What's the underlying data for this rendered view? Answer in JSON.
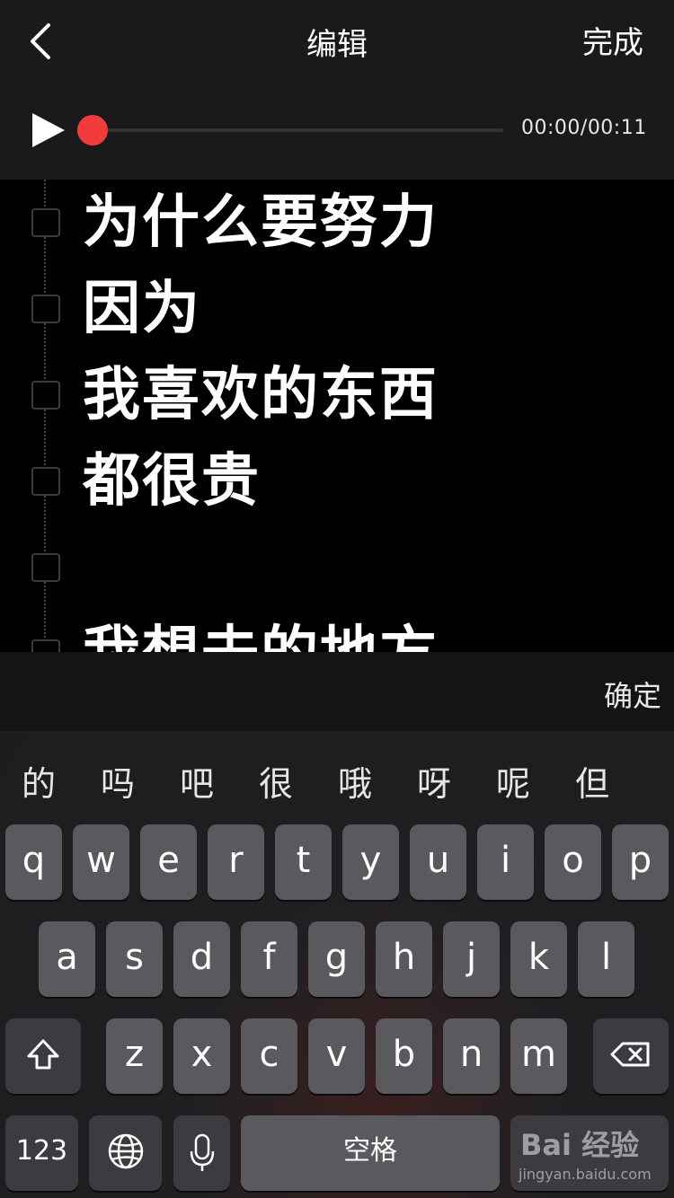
{
  "header": {
    "title": "编辑",
    "done_label": "完成"
  },
  "player": {
    "time": "00:00/00:11",
    "progress": 0
  },
  "lyrics": [
    "为什么要努力",
    "因为",
    "我喜欢的东西",
    "都很贵",
    "",
    "我想去的地方"
  ],
  "keyboard": {
    "confirm_label": "确定",
    "candidates": [
      "的",
      "吗",
      "吧",
      "很",
      "哦",
      "呀",
      "呢",
      "但"
    ],
    "row1": [
      "q",
      "w",
      "e",
      "r",
      "t",
      "y",
      "u",
      "i",
      "o",
      "p"
    ],
    "row2": [
      "a",
      "s",
      "d",
      "f",
      "g",
      "h",
      "j",
      "k",
      "l"
    ],
    "row3": [
      "z",
      "x",
      "c",
      "v",
      "b",
      "n",
      "m"
    ],
    "numbers_label": "123",
    "space_label": "空格"
  },
  "watermark": {
    "logo": "Bai 经验",
    "sub": "jingyan.baidu.com"
  }
}
